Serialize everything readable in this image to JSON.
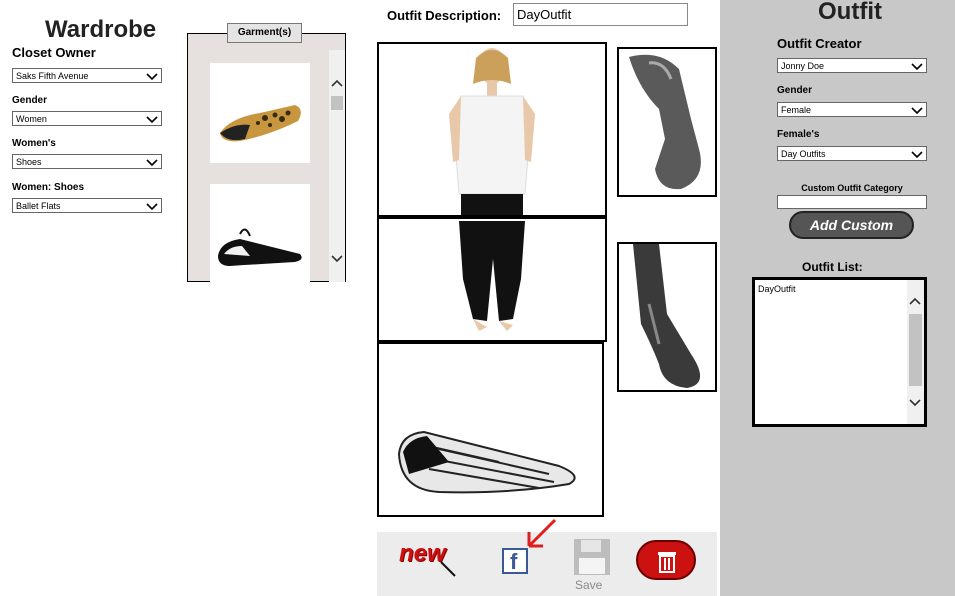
{
  "wardrobe": {
    "title": "Wardrobe",
    "closet_owner_label": "Closet Owner",
    "closet_owner_value": "Saks Fifth Avenue",
    "gender_label": "Gender",
    "gender_value": "Women",
    "category_label": "Women's",
    "category_value": "Shoes",
    "subcategory_label": "Women: Shoes",
    "subcategory_value": "Ballet Flats"
  },
  "garments": {
    "button_label": "Garment(s)"
  },
  "description": {
    "label": "Outfit Description:",
    "value": "DayOutfit"
  },
  "outfit": {
    "title": "Outfit",
    "creator_label": "Outfit Creator",
    "creator_value": "Jonny Doe",
    "gender_label": "Gender",
    "gender_value": "Female",
    "category_label": "Female's",
    "category_value": "Day Outfits",
    "custom_label": "Custom Outfit Category",
    "custom_value": "",
    "add_custom_label": "Add Custom",
    "list_label": "Outfit List:",
    "list_items": [
      "DayOutfit"
    ]
  },
  "toolbar": {
    "new_label": "new",
    "save_label": "Save"
  },
  "colors": {
    "panel_gray": "#c8c8c8",
    "accent_red": "#cc1111",
    "facebook_blue": "#3b5998"
  }
}
